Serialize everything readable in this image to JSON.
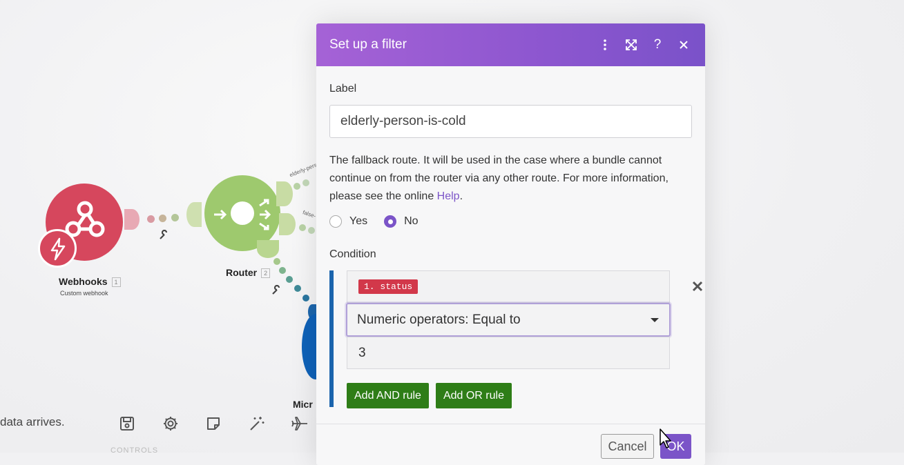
{
  "scenario": {
    "webhooks": {
      "title": "Webhooks",
      "num": "1",
      "subtitle": "Custom webhook"
    },
    "router": {
      "title": "Router",
      "num": "2"
    },
    "next_module": {
      "title": "Micr"
    },
    "route_labels": [
      "elderly-pers",
      "false-"
    ],
    "status_text": "data arrives.",
    "controls_label": "CONTROLS",
    "toolbar_icons": [
      "save-icon",
      "gear-icon",
      "note-icon",
      "magic-wand-icon",
      "airplane-icon"
    ]
  },
  "dialog": {
    "title": "Set up a filter",
    "header_icons": [
      "more-vertical-icon",
      "expand-icon",
      "help-icon",
      "close-icon"
    ],
    "label_caption": "Label",
    "label_value": "elderly-person-is-cold",
    "fallback_text": "The fallback route. It will be used in the case where a bundle cannot continue on from the router via any other route. For more information, please see the online ",
    "help_link": "Help",
    "fallback_end": ".",
    "yes_label": "Yes",
    "no_label": "No",
    "fallback_selected": "No",
    "condition_caption": "Condition",
    "condition": {
      "operand": "1. status",
      "operator": "Numeric operators: Equal to",
      "value": "3"
    },
    "add_and": "Add AND rule",
    "add_or": "Add OR rule",
    "cancel": "Cancel",
    "ok": "OK"
  },
  "colors": {
    "header_gradient_start": "#a562d6",
    "header_gradient_end": "#7a52c9",
    "accent": "#7b54c8",
    "webhook_red": "#d6475d",
    "router_green": "#9ec96e",
    "rule_button_green": "#2e7d17",
    "pill_red": "#d2384a",
    "condition_bar_blue": "#1b64ad"
  }
}
